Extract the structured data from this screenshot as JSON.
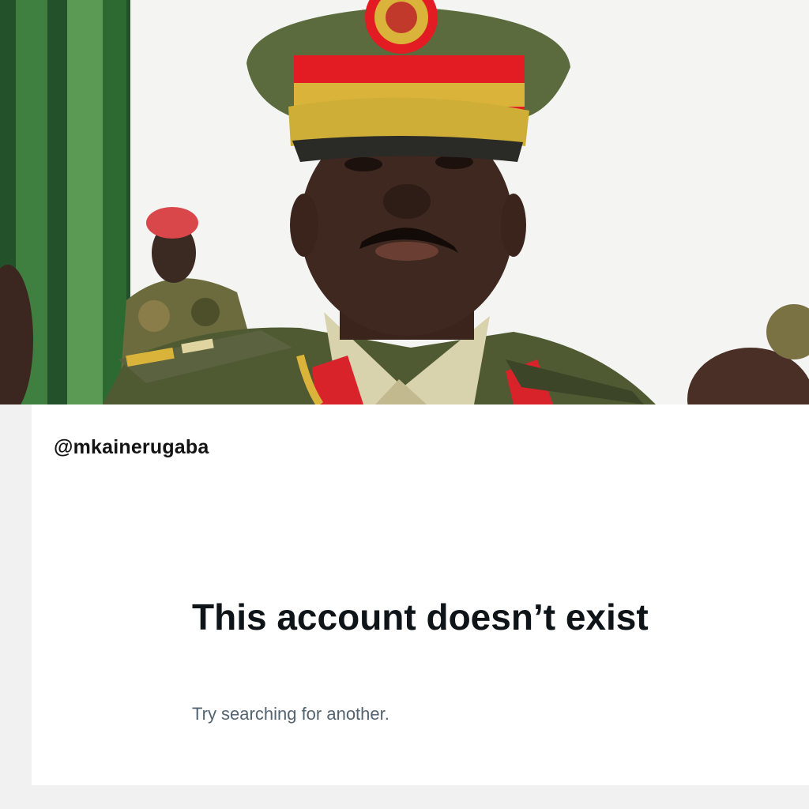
{
  "photo": {
    "alt_subject": "military-officer-portrait",
    "colors": {
      "uniform": "#4f5a33",
      "cap_band": "#e31b23",
      "gold": "#d9b33a",
      "background": "#f4f4f2",
      "curtain": "#2f6b34"
    }
  },
  "profile": {
    "handle": "@mkainerugaba"
  },
  "empty_state": {
    "title": "This account doesn’t exist",
    "subtitle": "Try searching for another."
  },
  "colors": {
    "title_text": "#0f1419",
    "subtitle_text": "#536471",
    "panel_border": "#f1f1f1"
  }
}
